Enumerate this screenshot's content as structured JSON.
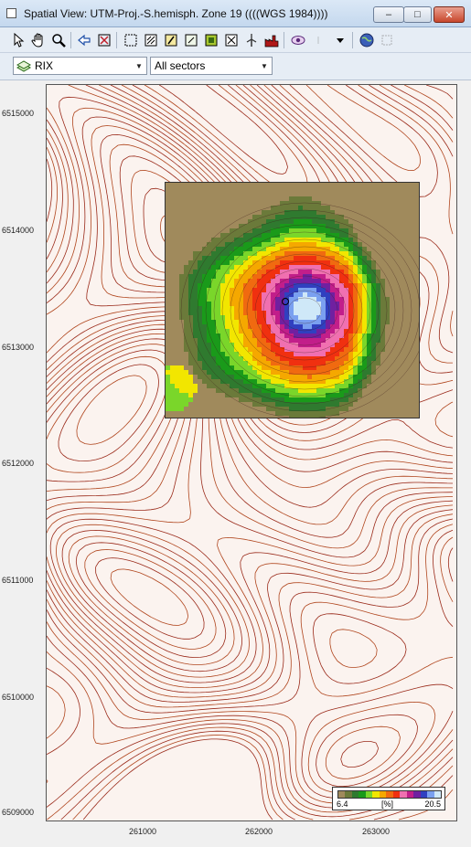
{
  "window": {
    "title": "Spatial View: UTM-Proj.-S.hemisph. Zone 19 ((((WGS 1984))))",
    "minimize_label": "–",
    "maximize_label": "□",
    "close_label": "✕"
  },
  "toolbar": {
    "tools": [
      "pointer-icon",
      "pan-hand-icon",
      "zoom-icon",
      "back-arrow-icon",
      "zoom-extent-icon",
      "select-rect-icon",
      "layer-a-icon",
      "layer-b-icon",
      "layer-c-icon",
      "layer-d-icon",
      "layer-e-icon",
      "turbine-icon",
      "factory-icon",
      "eye-icon",
      "dropdown-icon",
      "globe-icon",
      "frame-icon"
    ]
  },
  "selectors": {
    "layer_value": "RIX",
    "sector_value": "All sectors"
  },
  "map": {
    "y_ticks": [
      "6515000",
      "6514000",
      "6513000",
      "6512000",
      "6511000",
      "6510000",
      "6509000"
    ],
    "x_ticks": [
      "261000",
      "262000",
      "263000"
    ],
    "legend": {
      "min": "6.4",
      "unit": "[%]",
      "max": "20.5",
      "colors": [
        "#a08a5c",
        "#6b7a3a",
        "#2f7a2f",
        "#1a9a1a",
        "#7ad62a",
        "#f2e600",
        "#f5a800",
        "#f06a10",
        "#f03010",
        "#f070b0",
        "#c21e8a",
        "#7020a0",
        "#3040c0",
        "#7aa0f0",
        "#cfe8f8"
      ]
    }
  }
}
